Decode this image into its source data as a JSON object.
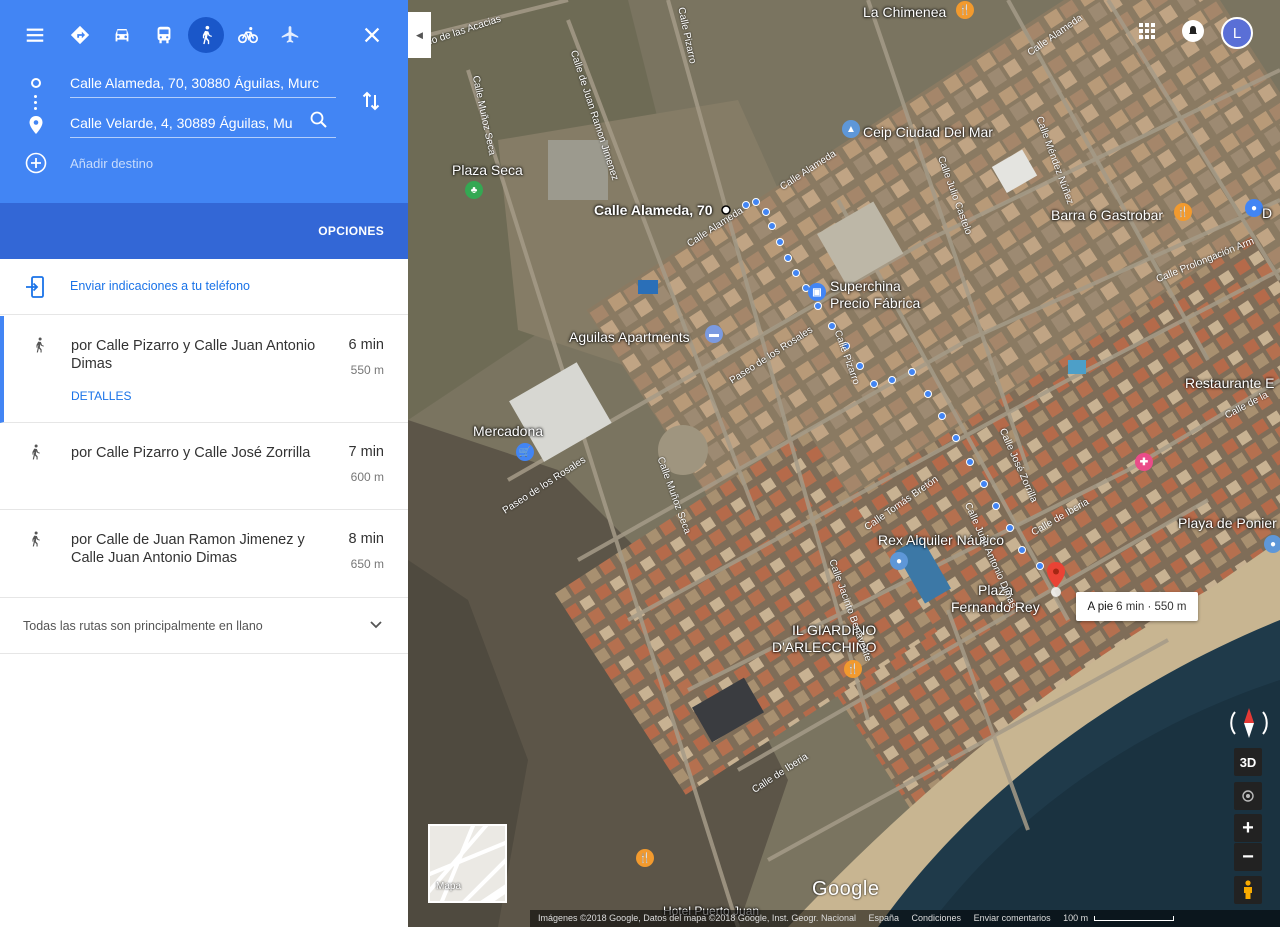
{
  "header": {
    "origin": "Calle Alameda, 70, 30880 Águilas, Murc",
    "destination": "Calle Velarde, 4, 30889 Águilas, Mu",
    "add_destination": "Añadir destino",
    "options_label": "OPCIONES",
    "travel_modes": [
      "menu",
      "best-route",
      "car",
      "transit",
      "walking",
      "cycling",
      "flight"
    ],
    "active_mode": "walking"
  },
  "send_to_phone": "Enviar indicaciones a tu teléfono",
  "routes": [
    {
      "description": "por Calle Pizarro y Calle Juan Antonio Dimas",
      "time": "6 min",
      "distance": "550 m",
      "details": "DETALLES",
      "selected": true
    },
    {
      "description": "por Calle Pizarro y Calle José Zorrilla",
      "time": "7 min",
      "distance": "600 m",
      "selected": false
    },
    {
      "description": "por Calle de Juan Ramon Jimenez y Calle Juan Antonio Dimas",
      "time": "8 min",
      "distance": "650 m",
      "selected": false
    }
  ],
  "flat_note": "Todas las rutas son principalmente en llano",
  "map": {
    "labels": {
      "chimenea": "La Chimenea",
      "ceip": "Ceip Ciudad Del Mar",
      "plaza_seca": "Plaza Seca",
      "alameda": "Calle Alameda, 70",
      "barra": "Barra 6 Gastrobar",
      "superchina_1": "Superchina",
      "superchina_2": "Precio Fábrica",
      "aguilas_apts": "Aguilas Apartments",
      "restaurante": "Restaurante E",
      "mercadona": "Mercadona",
      "playa": "Playa de Ponier",
      "rex": "Rex Alquiler Náutico",
      "plaza_fr_1": "Plaza",
      "plaza_fr_2": "Fernando Rey",
      "giardino_1": "IL GIARDINO",
      "giardino_2": "D'ARLECCHINO",
      "hotel": "Hotel Puerto Juan",
      "d_label": "D"
    },
    "streets": {
      "acacias": "Paseo de las Acacias",
      "juan_ramon": "Calle de Juan Ramon Jimenez",
      "munoz_seca_top": "Calle Muñoz Seca",
      "pizarro_top": "Calle Pizarro",
      "alameda_a": "Calle Alameda",
      "alameda_b": "Calle Alameda",
      "alameda_c": "Calle Alameda",
      "julio_castelo": "Calle Julio Castelo",
      "mendez_nunez": "Calle Méndez Núñez",
      "prolongacion": "Calle Prolongación Arm",
      "rosales_a": "Paseo de los Rosales",
      "rosales_b": "Paseo de los Rosales",
      "pizarro_mid": "Calle Pizarro",
      "munoz_seca_mid": "Calle Muñoz Seca",
      "tomas_breton": "Calle Tomás Bretón",
      "jose_zorrilla": "Calle José Zorrilla",
      "juan_dimas": "Calle Juan Antonio Dimas",
      "jacinto": "Calle Jacinto Benavente",
      "iberia_a": "Calle de Iberia",
      "iberia_b": "Calle de Iberia",
      "de_la": "Calle de la"
    },
    "tooltip_mode": "A pie",
    "tooltip_info": "6 min · 550 m",
    "minimap_label": "Mapa",
    "google": "Google",
    "ctrl_3d": "3D",
    "ctrl_plus": "+",
    "ctrl_minus": "−",
    "avatar_letter": "L",
    "footer": {
      "imagery": "Imágenes ©2018 Google, Datos del mapa ©2018 Google, Inst. Geogr. Nacional",
      "country": "España",
      "terms": "Condiciones",
      "feedback": "Enviar comentarios",
      "scale": "100 m"
    }
  },
  "colors": {
    "header_blue": "#4285f4",
    "options_blue": "#3367d6",
    "link_blue": "#1a73e8",
    "route_dots": "#4285f4",
    "destination_pin": "#ea4335"
  }
}
